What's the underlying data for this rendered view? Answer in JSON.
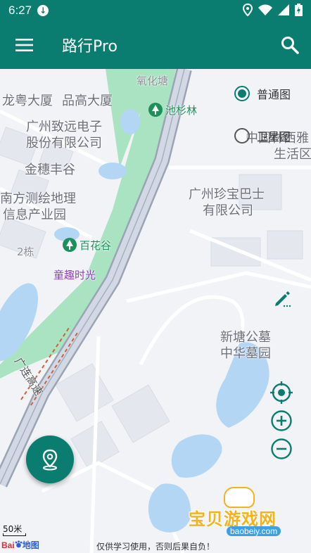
{
  "statusbar": {
    "time": "6:27",
    "download_icon": "↓"
  },
  "appbar": {
    "title": "路行Pro"
  },
  "map_type": {
    "normal_label": "普通图",
    "satellite_label": "卫星图",
    "selected": "普通图"
  },
  "map_labels": {
    "oxygen_tang": "氧化塘",
    "chishan_forest": "池杉林",
    "longyue": "龙粤大厦",
    "pingao": "品高大厦",
    "zhiyuan_1": "广州致远电子",
    "zhiyuan_2": "股份有限公司",
    "zhongyin_1": "中国林西雅",
    "zhongyin_2": "生活区",
    "jinsui": "金穗丰谷",
    "zhenbao_1": "广州珍宝巴士",
    "zhenbao_2": "有限公司",
    "nanfang_1": "南方测绘地理",
    "nanfang_2": "信息产业园",
    "building_2": "2栋",
    "baihuagu": "百花谷",
    "tongqu": "童趣时光",
    "xintang_1": "新塘公墓",
    "xintang_2": "中华墓园",
    "expressway": "广连高速"
  },
  "footer": {
    "scale_label": "50米",
    "map_brand_bai": "Bai",
    "map_brand_du": "地图",
    "disclaimer": "仅供学习使用，否则后果自负！"
  },
  "watermark": {
    "text": "宝贝游戏网",
    "url": "baobeiy.com"
  },
  "colors": {
    "primary": "#0b7d70",
    "park": "#a9e3c2",
    "water": "#b4d6f5",
    "road": "#d3d9e4"
  }
}
